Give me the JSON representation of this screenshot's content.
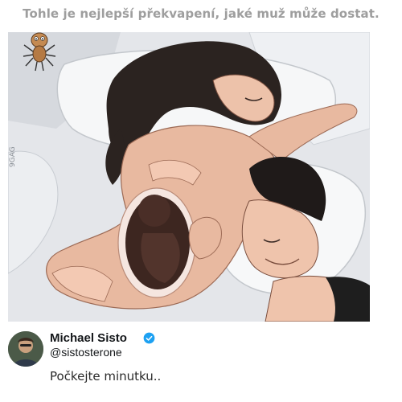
{
  "caption": "Tohle je nejlepší překvapení, jaké muž může dostat.",
  "logo": {
    "icon": "spider-mascot-icon"
  },
  "illustration": {
    "description_icon": "couple-in-bed-illustration",
    "watermark": "9GAG"
  },
  "tweet": {
    "author_name": "Michael Sisto",
    "handle": "@sistosterone",
    "verified_icon": "verified-badge-icon",
    "text": "Počkejte minutku.."
  },
  "colors": {
    "caption": "#9e9e9e",
    "verified": "#1da1f2",
    "skin": "#e8b9a0",
    "hair": "#2b2320"
  }
}
